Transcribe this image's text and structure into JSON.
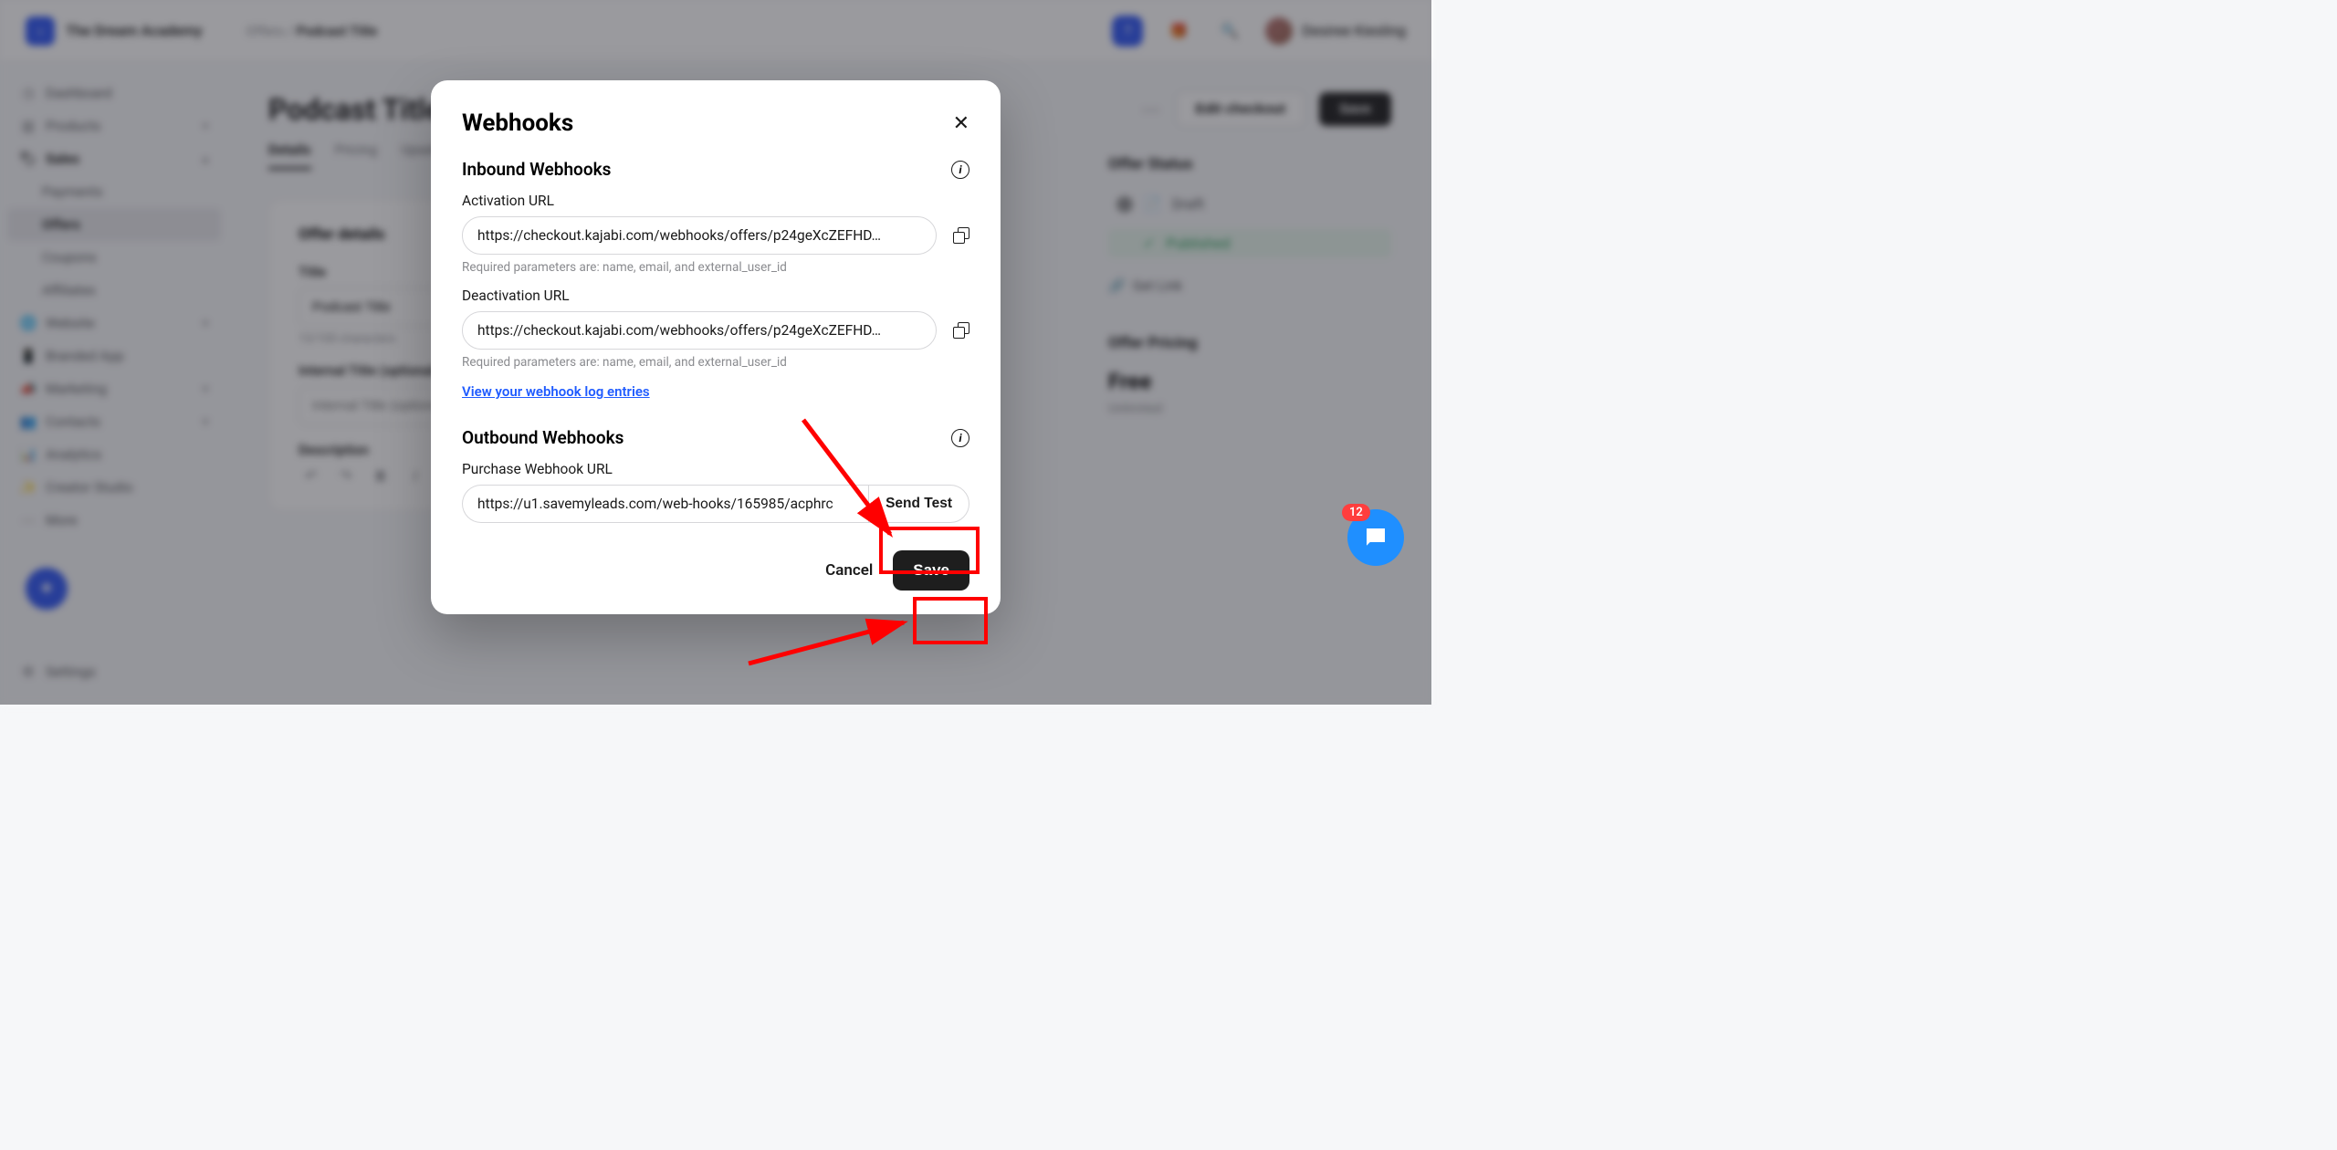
{
  "topbar": {
    "org_name": "The Dream Academy",
    "crumb_root": "Offers",
    "crumb_sep": "/",
    "crumb_leaf": "Podcast Title",
    "user_name": "Desiree Kiesling"
  },
  "sidebar": {
    "items": [
      {
        "label": "Dashboard"
      },
      {
        "label": "Products"
      },
      {
        "label": "Sales",
        "active": true
      },
      {
        "label": "Website"
      },
      {
        "label": "Branded App"
      },
      {
        "label": "Marketing"
      },
      {
        "label": "Contacts"
      },
      {
        "label": "Analytics"
      },
      {
        "label": "Creator Studio"
      },
      {
        "label": "More"
      }
    ],
    "sales_sub": [
      {
        "label": "Payments"
      },
      {
        "label": "Offers",
        "active": true
      },
      {
        "label": "Coupons"
      },
      {
        "label": "Affiliates"
      }
    ],
    "settings_label": "Settings"
  },
  "main": {
    "page_title": "Podcast Title",
    "edit_checkout_label": "Edit checkout",
    "save_label": "Save",
    "tabs": [
      {
        "label": "Details",
        "active": true
      },
      {
        "label": "Pricing"
      },
      {
        "label": "Upsell"
      }
    ],
    "offer_details_heading": "Offer details",
    "title_label": "Title",
    "title_value": "Podcast Title",
    "title_hint": "13/100 characters",
    "internal_title_label": "Internal Title (optional)",
    "internal_title_ph": "Internal Title (optional)",
    "description_label": "Description"
  },
  "right": {
    "status_heading": "Offer Status",
    "draft_label": "Draft",
    "published_label": "Published",
    "getlink_label": "Get Link",
    "pricing_heading": "Offer Pricing",
    "pricing_value": "Free",
    "pricing_unlimited": "Unlimited"
  },
  "modal": {
    "title": "Webhooks",
    "inbound_heading": "Inbound Webhooks",
    "activation_label": "Activation URL",
    "activation_value": "https://checkout.kajabi.com/webhooks/offers/p24geXcZEFHD…",
    "deactivation_label": "Deactivation URL",
    "deactivation_value": "https://checkout.kajabi.com/webhooks/offers/p24geXcZEFHD…",
    "params_hint": "Required parameters are: name, email, and external_user_id",
    "log_link": "View your webhook log entries",
    "outbound_heading": "Outbound Webhooks",
    "purchase_label": "Purchase Webhook URL",
    "purchase_value": "https://u1.savemyleads.com/web-hooks/165985/acphrc",
    "send_test_label": "Send Test",
    "cancel_label": "Cancel",
    "save_label": "Save"
  },
  "fab": {
    "count": "12"
  }
}
